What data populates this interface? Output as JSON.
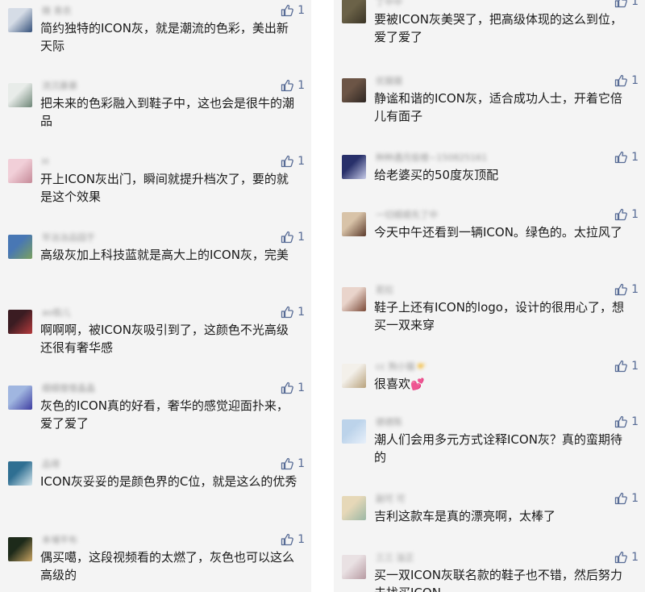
{
  "left_comments": [
    {
      "username": "微 青衣",
      "likes": "1",
      "text": "简约独特的ICON灰，就是潮流的色彩，美出新天际",
      "avatar": [
        "#d5dce6",
        "#34507a"
      ]
    },
    {
      "username": "流沉暴暴",
      "likes": "1",
      "text": "把未来的色彩融入到鞋子中，这也会是很牛的潮品",
      "avatar": [
        "#e8ece9",
        "#6d8576"
      ]
    },
    {
      "username": "H",
      "likes": "1",
      "text": "开上ICON灰出门，瞬间就提升档次了，要的就是这个效果",
      "avatar": [
        "#f1cfd8",
        "#c58a98"
      ]
    },
    {
      "username": "毕冶冶品园于",
      "likes": "1",
      "text": "高级灰加上科技蓝就是高大上的ICON灰，完美",
      "avatar": [
        "#4877b4",
        "#7aa060"
      ]
    },
    {
      "username": "ao极儿",
      "likes": "1",
      "text": "啊啊啊，被ICON灰吸引到了，这颜色不光高级还很有奢华感",
      "avatar": [
        "#3b1c22",
        "#b53a3c"
      ]
    },
    {
      "username": "细细僧僧晶晶",
      "likes": "1",
      "text": "灰色的ICON真的好看，奢华的感觉迎面扑来，爱了爱了",
      "avatar": [
        "#a0b6e0",
        "#3e3da1"
      ]
    },
    {
      "username": "品得",
      "likes": "1",
      "text": "ICON灰妥妥的是颜色界的C位，就是这么的优秀",
      "avatar": [
        "#2f6f92",
        "#d7e8ee"
      ]
    },
    {
      "username": "本埔平布",
      "likes": "1",
      "text": "偶买噶，这段视频看的太燃了，灰色也可以这么高级的",
      "avatar": [
        "#1d2a1a",
        "#c9a462"
      ]
    }
  ],
  "right_comments": [
    {
      "username": "丁中中",
      "likes": "1",
      "text": "要被ICON灰美哭了，把高级体现的这么到位，爱了爱了",
      "avatar": [
        "#6b6248",
        "#3a3425"
      ],
      "heart": ""
    },
    {
      "username": "优摄摄",
      "likes": "1",
      "text": "静谧和谐的ICON灰，适合成功人士，开着它倍儿有面子",
      "avatar": [
        "#6c5546",
        "#2e2622"
      ],
      "heart": ""
    },
    {
      "username": "种种遇月投楼~150825161",
      "likes": "1",
      "text": "给老婆买的50度灰顶配",
      "avatar": [
        "#28306a",
        "#c7cbe8"
      ],
      "heart": ""
    },
    {
      "username": "一切顺顺先了中",
      "likes": "1",
      "text": "今天中午还看到一辆ICON。绿色的。太拉风了",
      "avatar": [
        "#d8c3a8",
        "#5c3b2c"
      ],
      "heart": ""
    },
    {
      "username": "若拉",
      "likes": "1",
      "text": "鞋子上还有ICON的logo，设计的很用心了，想买一双来穿",
      "avatar": [
        "#e9d4cb",
        "#7b4a38"
      ],
      "heart": ""
    },
    {
      "username": "cc 狗小猫",
      "likes": "1",
      "text": "很喜欢",
      "avatar": [
        "#f3f0ea",
        "#b8a27c"
      ],
      "heart": "💕"
    },
    {
      "username": "德德陈",
      "likes": "1",
      "text": "潮人们会用多元方式诠释ICON灰？真的蛮期待的",
      "avatar": [
        "#bcd3ea",
        "#e8f0fa"
      ],
      "heart": ""
    },
    {
      "username": "副可 可",
      "likes": "1",
      "text": "吉利这款车是真的漂亮啊，太棒了",
      "avatar": [
        "#e6d8b8",
        "#9bb7a5"
      ],
      "heart": ""
    },
    {
      "username": "三三 溢正",
      "likes": "1",
      "text": "买一双ICON灰联名款的鞋子也不错，然后努力去找买ICON",
      "avatar": [
        "#e9e1e3",
        "#b79aa2"
      ],
      "heart": ""
    }
  ]
}
